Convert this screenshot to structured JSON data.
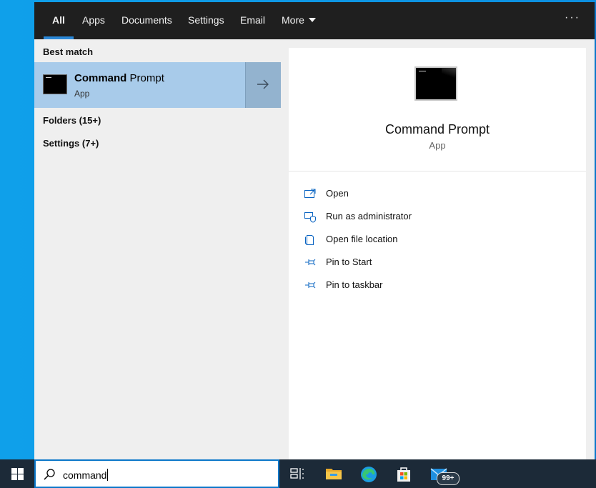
{
  "tabs": [
    {
      "label": "All",
      "active": true
    },
    {
      "label": "Apps"
    },
    {
      "label": "Documents"
    },
    {
      "label": "Settings"
    },
    {
      "label": "Email"
    },
    {
      "label": "More"
    }
  ],
  "best_match": {
    "heading": "Best match",
    "title_bold": "Command",
    "title_rest": " Prompt",
    "subtitle": "App"
  },
  "groups": [
    {
      "label": "Folders (15+)"
    },
    {
      "label": "Settings (7+)"
    }
  ],
  "detail": {
    "title": "Command Prompt",
    "subtitle": "App",
    "actions": [
      {
        "label": "Open",
        "icon": "open-icon"
      },
      {
        "label": "Run as administrator",
        "icon": "run-as-admin-icon"
      },
      {
        "label": "Open file location",
        "icon": "file-location-icon"
      },
      {
        "label": "Pin to Start",
        "icon": "pin-icon"
      },
      {
        "label": "Pin to taskbar",
        "icon": "pin-icon"
      }
    ]
  },
  "search": {
    "value": "command"
  },
  "taskbar": {
    "mail_badge": "99+"
  },
  "colors": {
    "accent": "#2b88d8",
    "selection": "#a8cbea",
    "taskbar": "#1c2a38"
  }
}
